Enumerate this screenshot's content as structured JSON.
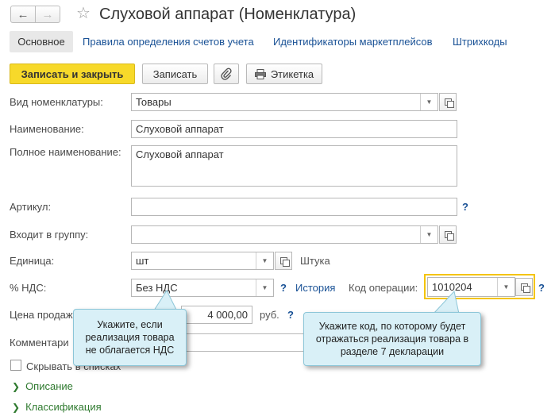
{
  "header": {
    "back_icon": "←",
    "forward_icon": "→",
    "star_icon": "☆",
    "title": "Слуховой аппарат (Номенклатура)"
  },
  "tabs": [
    {
      "label": "Основное"
    },
    {
      "label": "Правила определения счетов учета"
    },
    {
      "label": "Идентификаторы маркетплейсов"
    },
    {
      "label": "Штрихкоды"
    }
  ],
  "toolbar": {
    "save_close_label": "Записать и закрыть",
    "save_label": "Записать",
    "attach_icon": "paperclip-icon",
    "label_button_label": "Этикетка"
  },
  "form": {
    "vid_label": "Вид номенклатуры:",
    "vid_value": "Товары",
    "name_label": "Наименование:",
    "name_value": "Слуховой аппарат",
    "fullname_label": "Полное наименование:",
    "fullname_value": "Слуховой аппарат",
    "article_label": "Артикул:",
    "article_value": "",
    "group_label": "Входит в группу:",
    "group_value": "",
    "unit_label": "Единица:",
    "unit_value": "шт",
    "unit_fullname": "Штука",
    "vat_label": "% НДС:",
    "vat_value": "Без НДС",
    "history_link": "История",
    "opcode_label": "Код операции:",
    "opcode_value": "1010204",
    "price_label": "Цена продаж",
    "price_value": "4 000,00",
    "price_currency": "руб.",
    "comment_label": "Комментари",
    "hide_label": "Скрывать в списках",
    "question_mark": "?"
  },
  "groups": [
    {
      "label": "Описание"
    },
    {
      "label": "Классификация"
    }
  ],
  "tooltips": {
    "vat_tip": "Укажите, если реализация товара не облагается НДС",
    "opcode_tip": "Укажите код, по которому будет отражаться реализация товара в разделе 7 декларации"
  }
}
